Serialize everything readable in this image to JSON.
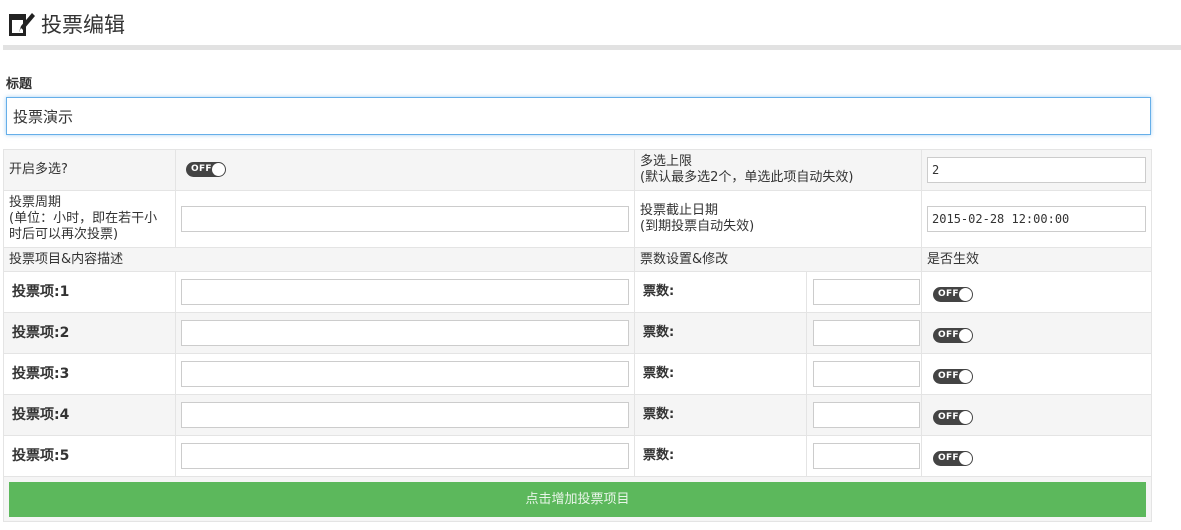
{
  "header": {
    "title": "投票编辑",
    "icon": "edit-icon"
  },
  "form": {
    "title_label": "标题",
    "title_value": "投票演示",
    "multi_select_label": "开启多选?",
    "multi_select_toggle": "OFF",
    "max_select_label": "多选上限",
    "max_select_hint": "(默认最多选2个，单选此项自动失效)",
    "max_select_value": "2",
    "cycle_label": "投票周期",
    "cycle_hint": "(单位：小时，即在若干小时后可以再次投票)",
    "cycle_value": "",
    "deadline_label": "投票截止日期",
    "deadline_hint": "(到期投票自动失效)",
    "deadline_value": "2015-02-28 12:00:00"
  },
  "items_header": {
    "item_desc": "投票项目&内容描述",
    "votes": "票数设置&修改",
    "active": "是否生效"
  },
  "items": [
    {
      "label": "投票项:1",
      "votes_label": "票数:",
      "toggle": "OFF"
    },
    {
      "label": "投票项:2",
      "votes_label": "票数:",
      "toggle": "OFF"
    },
    {
      "label": "投票项:3",
      "votes_label": "票数:",
      "toggle": "OFF"
    },
    {
      "label": "投票项:4",
      "votes_label": "票数:",
      "toggle": "OFF"
    },
    {
      "label": "投票项:5",
      "votes_label": "票数:",
      "toggle": "OFF"
    }
  ],
  "add_button": "点击增加投票项目",
  "colors": {
    "accent_green": "#5cb85c",
    "focus_blue": "#66afe9",
    "toggle_off": "#444444"
  }
}
